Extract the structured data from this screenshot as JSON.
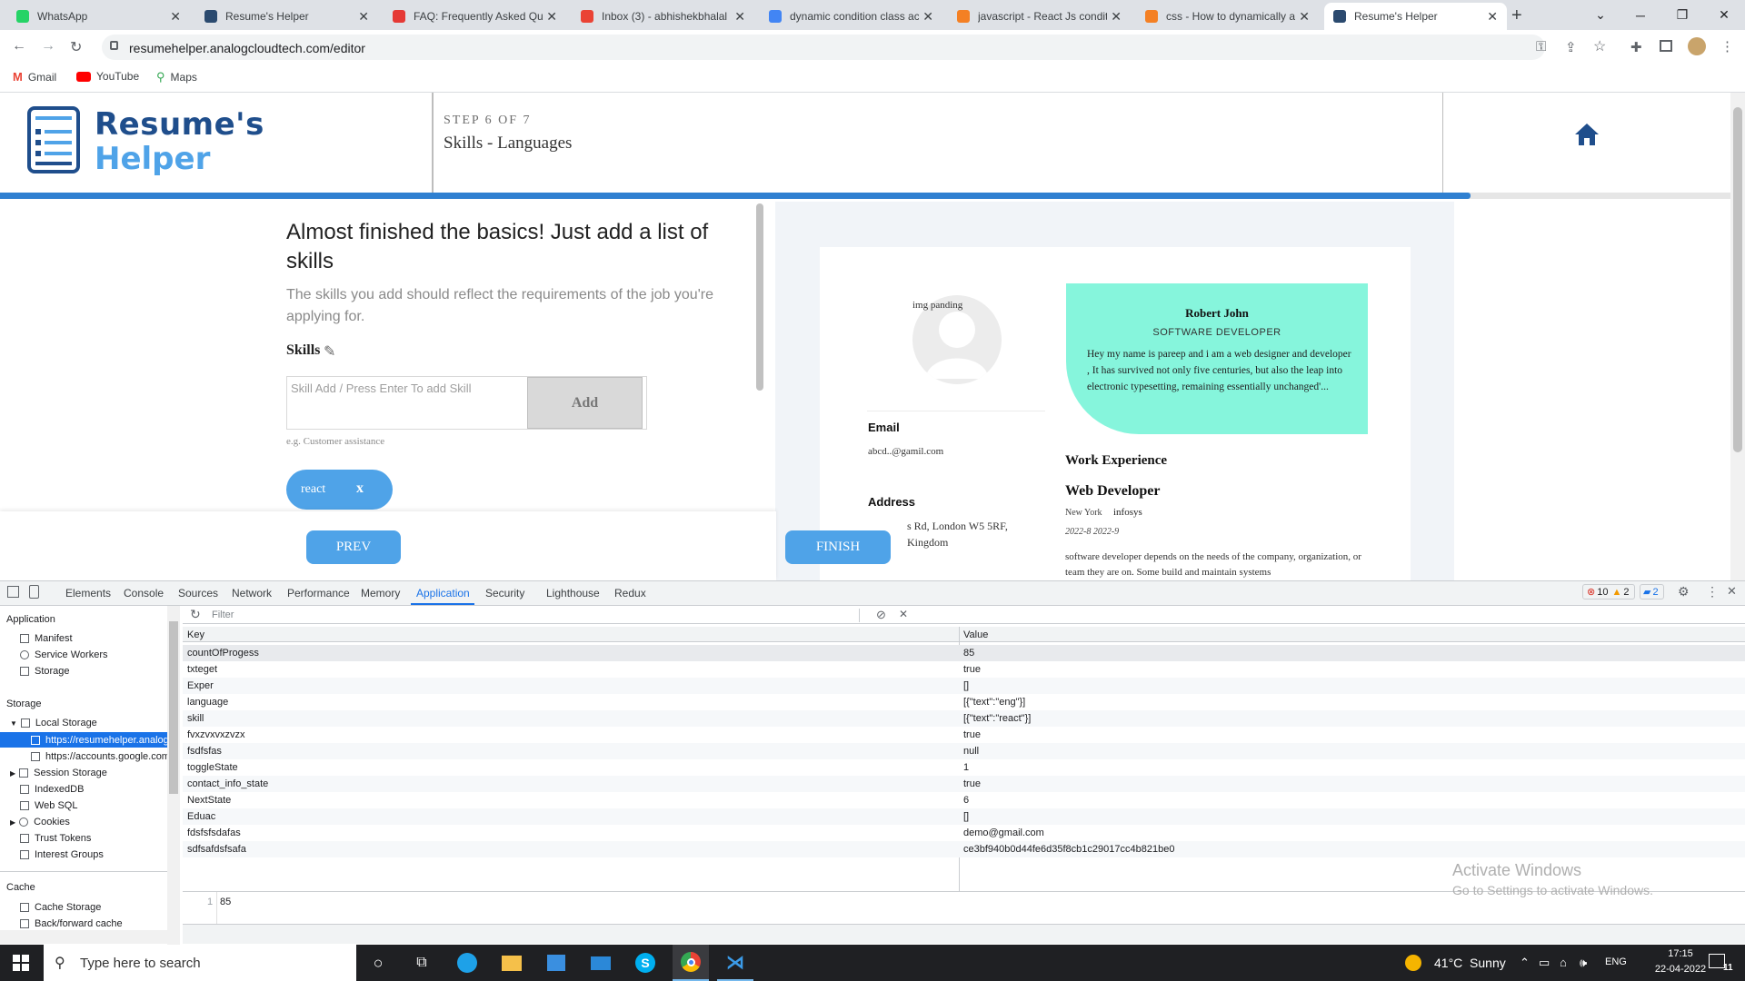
{
  "browser": {
    "tabs": [
      {
        "title": "WhatsApp",
        "icon": "whatsapp-icon",
        "color": "#25d366"
      },
      {
        "title": "Resume's Helper",
        "icon": "resume-helper-icon",
        "color": "#2b4a6f"
      },
      {
        "title": "FAQ: Frequently Asked Qu",
        "icon": "faq-icon",
        "color": "#e53935"
      },
      {
        "title": "Inbox (3) - abhishekbhalal",
        "icon": "gmail-icon",
        "color": "#ea4335"
      },
      {
        "title": "dynamic condition class ac",
        "icon": "google-icon",
        "color": "#4285f4"
      },
      {
        "title": "javascript - React Js condit",
        "icon": "stackoverflow-icon",
        "color": "#f48024"
      },
      {
        "title": "css - How to dynamically a",
        "icon": "stackoverflow-icon",
        "color": "#f48024"
      },
      {
        "title": "Resume's Helper",
        "icon": "resume-helper-icon",
        "color": "#2b4a6f",
        "active": true
      }
    ],
    "new_tab": "+",
    "url": "resumehelper.analogcloudtech.com/editor",
    "bookmarks": [
      "Gmail",
      "YouTube",
      "Maps"
    ]
  },
  "app": {
    "logo_line1": "Resume's",
    "logo_line2": "Helper",
    "step_label": "STEP 6 OF 7",
    "step_title": "Skills - Languages",
    "progress_percent": 85,
    "heading": "Almost finished the basics! Just add a list of skills",
    "subtext": "The skills you add should reflect the requirements of the job you're applying for.",
    "skills_label": "Skills",
    "skill_placeholder": "Skill Add / Press Enter To add Skill",
    "add_button": "Add",
    "example_hint": "e.g. Customer assistance",
    "chips": [
      {
        "label": "react",
        "remove": "x"
      }
    ],
    "prev_button": "PREV",
    "finish_button": "FINISH"
  },
  "resume": {
    "img_alt": "img panding",
    "name": "Robert John",
    "role": "SOFTWARE DEVELOPER",
    "summary": "Hey my name is pareep and i am a web designer and developer , It has survived not only five centuries, but also the leap into electronic typesetting, remaining essentially unchanged'...",
    "email_label": "Email",
    "email_value": "abcd..@gamil.com",
    "address_label": "Address",
    "address_line1": "s Rd, London W5 5RF,",
    "address_line2": "Kingdom",
    "work_title": "Work Experience",
    "job_title": "Web Developer",
    "job_city": "New York",
    "job_company": "infosys",
    "job_dates": "2022-8 2022-9",
    "job_desc": "software developer depends on the needs of the company, organization, or team they are on. Some build and maintain systems",
    "accent_color": "#86f5dc"
  },
  "devtools": {
    "tabs": [
      "Elements",
      "Console",
      "Sources",
      "Network",
      "Performance",
      "Memory",
      "Application",
      "Security",
      "Lighthouse",
      "Redux"
    ],
    "active_tab": "Application",
    "errors": "10",
    "warnings": "2",
    "messages": "2",
    "sidebar": {
      "application_header": "Application",
      "application_items": [
        "Manifest",
        "Service Workers",
        "Storage"
      ],
      "storage_header": "Storage",
      "local_storage": "Local Storage",
      "local_children": [
        "https://resumehelper.analog",
        "https://accounts.google.com"
      ],
      "storage_items": [
        "Session Storage",
        "IndexedDB",
        "Web SQL",
        "Cookies",
        "Trust Tokens",
        "Interest Groups"
      ],
      "cache_header": "Cache",
      "cache_items": [
        "Cache Storage",
        "Back/forward cache"
      ]
    },
    "filter_placeholder": "Filter",
    "col_key": "Key",
    "col_value": "Value",
    "rows": [
      {
        "key": "countOfProgess",
        "value": "85"
      },
      {
        "key": "txteget",
        "value": "true"
      },
      {
        "key": "Exper",
        "value": "[]"
      },
      {
        "key": "language",
        "value": "[{\"text\":\"eng\"}]"
      },
      {
        "key": "skill",
        "value": "[{\"text\":\"react\"}]"
      },
      {
        "key": "fvxzvxvxzvzx",
        "value": "true"
      },
      {
        "key": "fsdfsfas",
        "value": "null"
      },
      {
        "key": "toggleState",
        "value": "1"
      },
      {
        "key": "contact_info_state",
        "value": "true"
      },
      {
        "key": "NextState",
        "value": "6"
      },
      {
        "key": "Eduac",
        "value": "[]"
      },
      {
        "key": "fdsfsfsdafas",
        "value": "demo@gmail.com"
      },
      {
        "key": "sdfsafdsfsafa",
        "value": "ce3bf940b0d44fe6d35f8cb1c29017cc4b821be0"
      }
    ],
    "preview_line": "1",
    "preview_value": "85"
  },
  "watermark": {
    "line1": "Activate Windows",
    "line2": "Go to Settings to activate Windows."
  },
  "taskbar": {
    "search_placeholder": "Type here to search",
    "weather": "41°C  Sunny",
    "language": "ENG",
    "time": "17:15",
    "date": "22-04-2022",
    "notification_count": "11"
  }
}
